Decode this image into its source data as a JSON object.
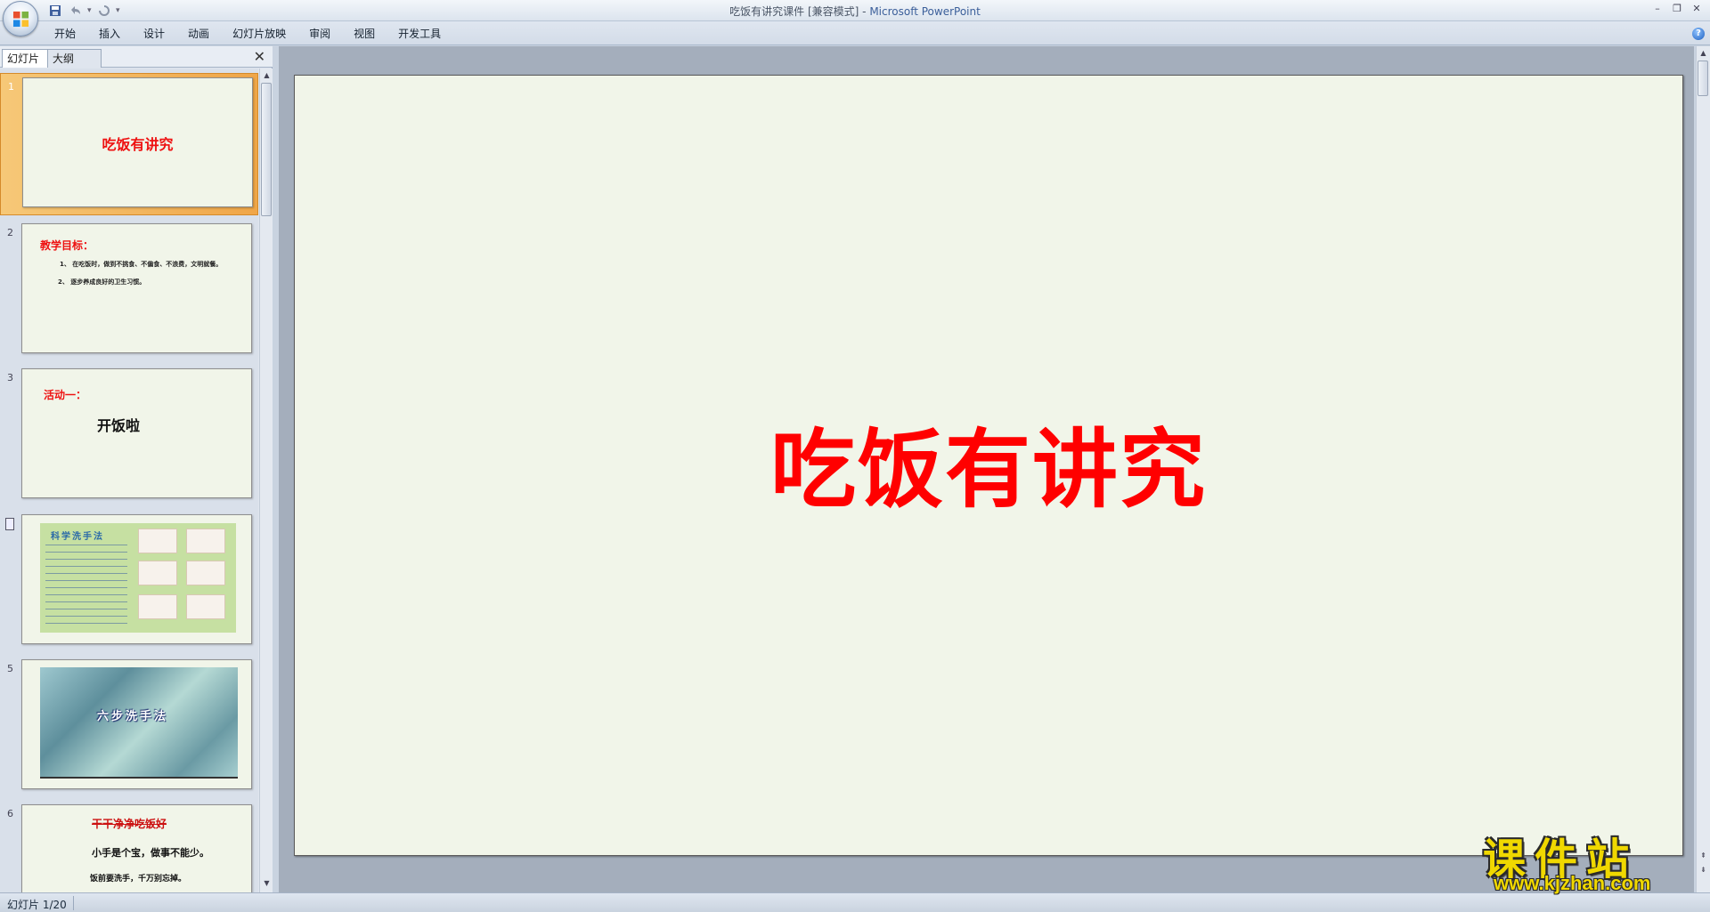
{
  "window": {
    "title_doc": "吃饭有讲究课件 [兼容模式] - ",
    "title_app": "Microsoft PowerPoint"
  },
  "quick_access": {
    "icons": [
      "save-icon",
      "undo-icon",
      "redo-icon",
      "customize-icon"
    ]
  },
  "ribbon": {
    "tabs": [
      "开始",
      "插入",
      "设计",
      "动画",
      "幻灯片放映",
      "审阅",
      "视图",
      "开发工具"
    ],
    "help_label": "?"
  },
  "pane": {
    "tab_slides": "幻灯片",
    "tab_outline": "大纲",
    "close_label": "✕"
  },
  "thumbnails": [
    {
      "num": "1",
      "title": "吃饭有讲究"
    },
    {
      "num": "2",
      "title": "教学目标：",
      "lines": [
        "1、 在吃饭时，做到不挑食、不偏食、不浪费，文明就餐。",
        "2、 逐步养成良好的卫生习惯。"
      ]
    },
    {
      "num": "3",
      "title": "活动一：",
      "subtitle": "开饭啦"
    },
    {
      "num": "4",
      "image_heading": "科学洗手法"
    },
    {
      "num": "5",
      "image_caption": "六步洗手法"
    },
    {
      "num": "6",
      "title": "干干净净吃饭好",
      "lines": [
        "小手是个宝，做事不能少。",
        "饭前要洗手，千万别忘掉。"
      ]
    }
  ],
  "slide": {
    "title": "吃饭有讲究",
    "title_color": "#ff0000",
    "background": "#f1f5e9"
  },
  "status": {
    "slide_indicator": "幻灯片 1/20"
  },
  "watermark": {
    "text": "课件站",
    "url": "www.kjzhan.com"
  }
}
